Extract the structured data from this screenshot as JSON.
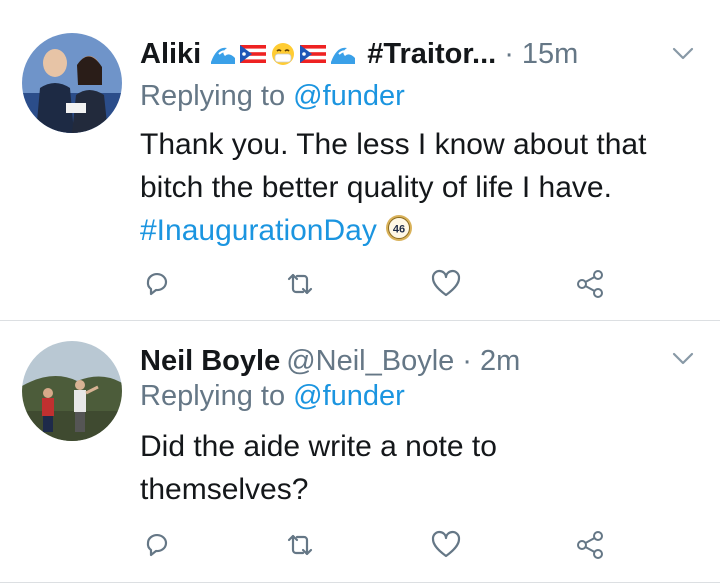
{
  "tweets": [
    {
      "name": "Aliki",
      "name_suffix": "#Traitor...",
      "handle": "",
      "time": "· 15m",
      "replying_prefix": "Replying to",
      "replying_to": "@funder",
      "body_text": "Thank you. The less I know about that bitch the better quality of life I have.",
      "hashtag": "#InaugurationDay",
      "badge": "46"
    },
    {
      "name": "Neil Boyle",
      "handle": "@Neil_Boyle",
      "time": "· 2m",
      "replying_prefix": "Replying to",
      "replying_to": "@funder",
      "body_text": "Did the aide write a note to themselves?"
    }
  ],
  "icons": [
    "reply-icon",
    "retweet-icon",
    "like-icon",
    "share-icon",
    "chevron-down-icon"
  ],
  "colors": {
    "link": "#1b95e0",
    "muted": "#657786",
    "text": "#14171a",
    "divider": "#dcdfe2"
  }
}
